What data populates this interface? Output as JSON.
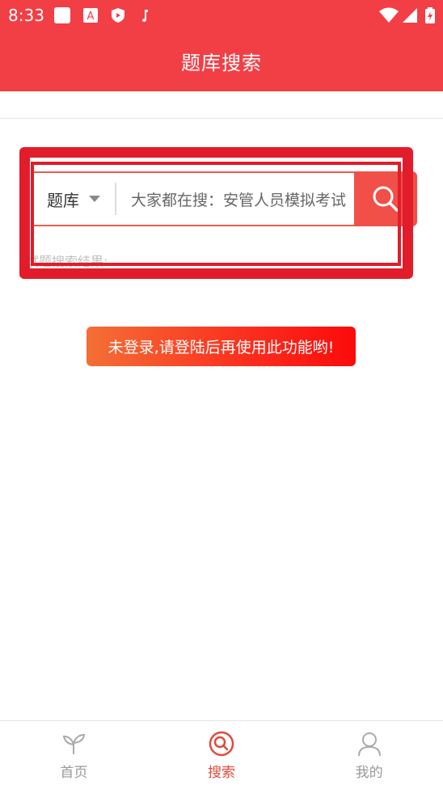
{
  "status_bar": {
    "time": "8:33",
    "icons": [
      "app-icon",
      "a-icon",
      "shield-icon",
      "music-icon"
    ],
    "right_icons": [
      "wifi-icon",
      "signal-icon",
      "battery-icon"
    ]
  },
  "header": {
    "title": "题库搜索"
  },
  "search": {
    "category": "题库",
    "placeholder": "大家都在搜：安管人员模拟考试"
  },
  "result_label": "试题搜索结果:",
  "notice": "未登录,请登陆后再使用此功能哟!",
  "bottom_nav": {
    "items": [
      {
        "label": "首页",
        "icon": "sprout-icon"
      },
      {
        "label": "搜索",
        "icon": "search-icon",
        "active": true
      },
      {
        "label": "我的",
        "icon": "user-icon"
      }
    ]
  },
  "colors": {
    "brand": "#f23f45",
    "accent": "#f05048",
    "active_tab": "#e24a3b",
    "highlight_box": "#e21c2a"
  }
}
